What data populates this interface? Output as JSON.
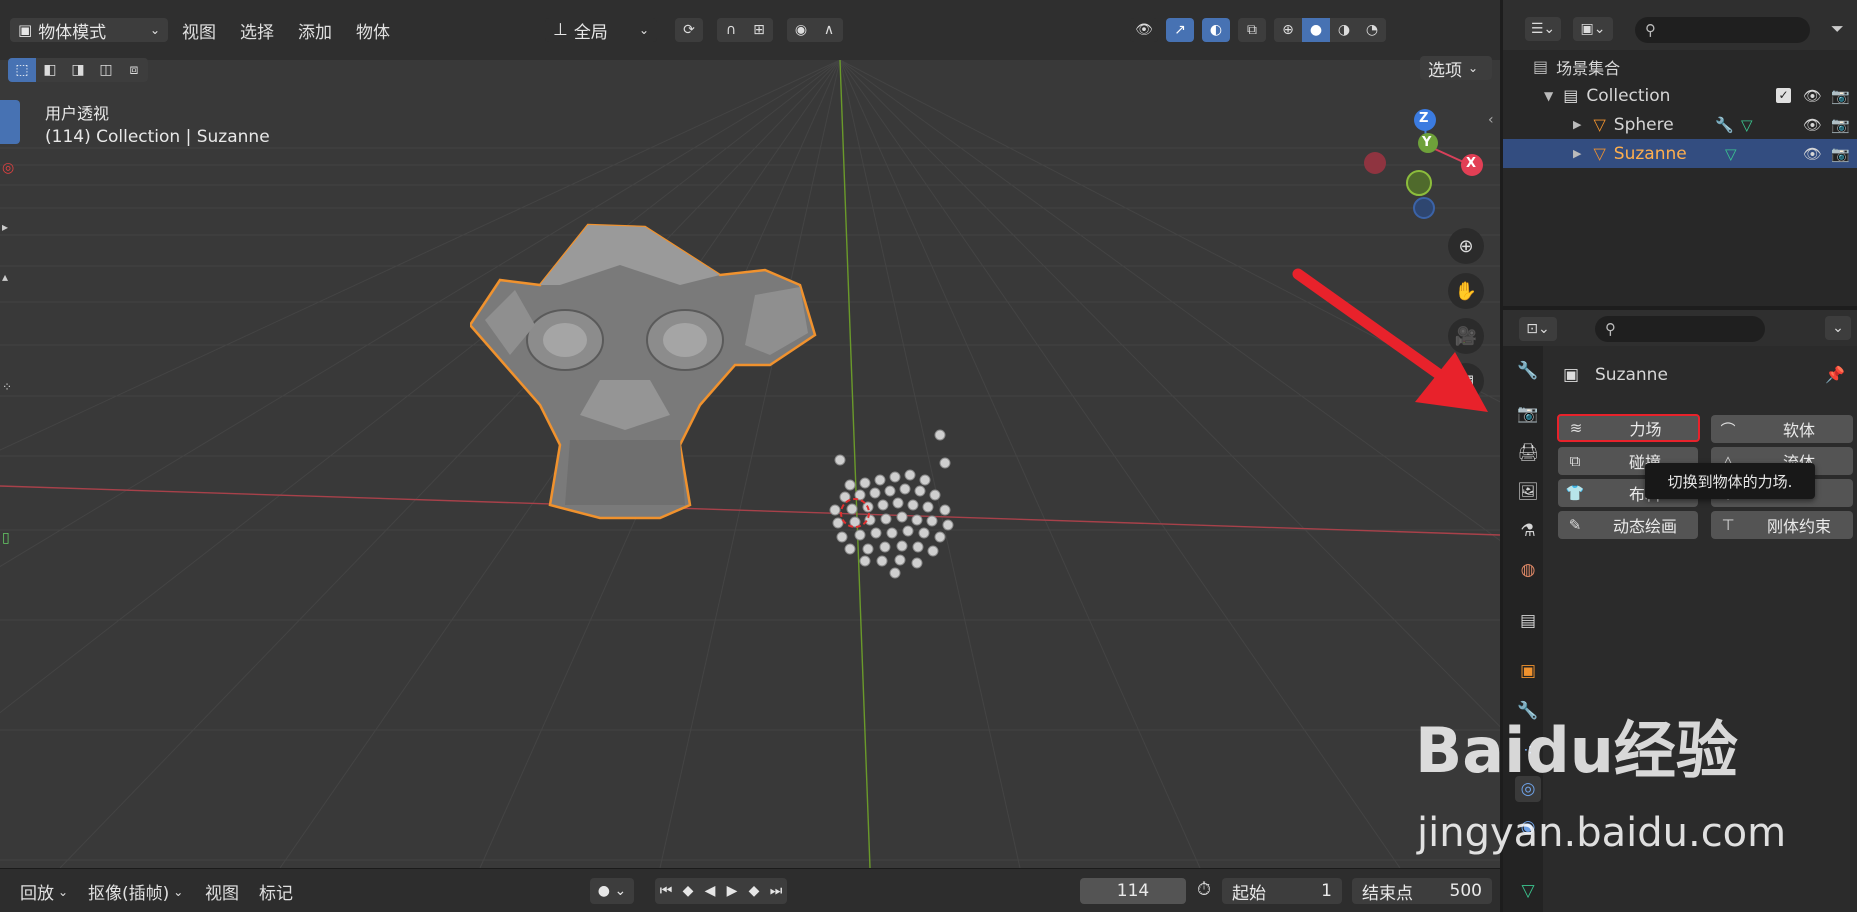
{
  "header": {
    "mode": "物体模式",
    "menus": [
      "视图",
      "选择",
      "添加",
      "物体"
    ],
    "transform_orientation": "全局",
    "options": "选项"
  },
  "viewport": {
    "view_name": "用户透视",
    "object_info": "(114) Collection | Suzanne",
    "gizmo_axes": [
      "Z",
      "Y",
      "X"
    ]
  },
  "timeline": {
    "playback": "回放",
    "keying": "抠像(插帧)",
    "view": "视图",
    "marker": "标记",
    "current_frame": "114",
    "start_label": "起始",
    "start_value": "1",
    "end_label": "结束点",
    "end_value": "500"
  },
  "outliner": {
    "scene_collection": "场景集合",
    "items": [
      {
        "name": "Collection"
      },
      {
        "name": "Sphere"
      },
      {
        "name": "Suzanne"
      }
    ]
  },
  "properties": {
    "object_name": "Suzanne",
    "buttons": {
      "force_field": "力场",
      "soft_body": "软体",
      "collision": "碰撞",
      "fluid": "流体",
      "cloth": "布料",
      "dynamic_paint": "动态绘画",
      "rigid_body_constraint": "刚体约束"
    },
    "tooltip": "切换到物体的力场."
  },
  "watermark": {
    "brand": "Baidu经验",
    "url": "jingyan.baidu.com"
  },
  "colors": {
    "accent_blue": "#4772b3",
    "selection_orange": "#f0922e",
    "annotation_red": "#e8222b",
    "selected_row": "#334d80"
  }
}
